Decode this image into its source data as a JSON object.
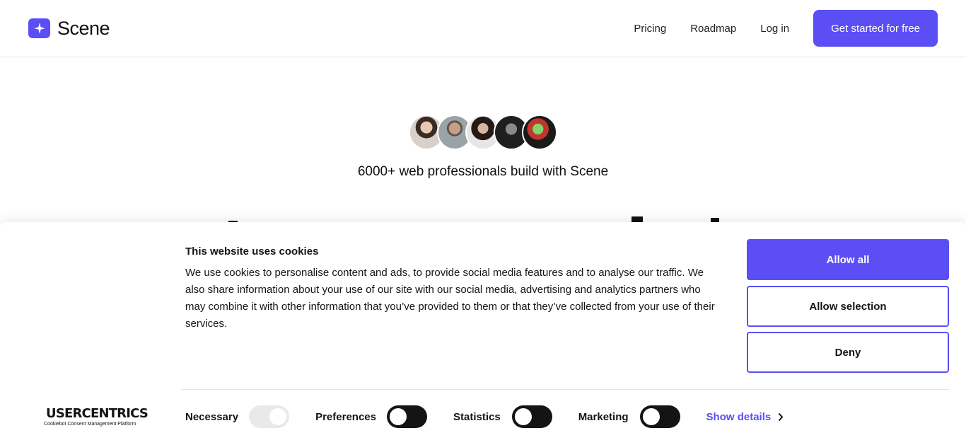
{
  "header": {
    "brand": "Scene",
    "nav": [
      "Pricing",
      "Roadmap",
      "Log in"
    ],
    "cta": "Get started for free"
  },
  "hero": {
    "tagline": "6000+ web professionals build with Scene",
    "headline_partial": "I",
    "avatar_count": 5
  },
  "cookie_banner": {
    "title": "This website uses cookies",
    "body": "We use cookies to personalise content and ads, to provide social media features and to analyse our traffic. We also share information about your use of our site with our social media, advertising and analytics partners who may combine it with other information that you’ve provided to them or that they’ve collected from your use of their services.",
    "buttons": {
      "allow_all": "Allow all",
      "allow_selection": "Allow selection",
      "deny": "Deny"
    },
    "provider": {
      "name": "USERCENTRICS",
      "subtitle": "Cookiebot Consent Management Platform"
    },
    "consents": [
      {
        "label": "Necessary",
        "on": true,
        "disabled": true
      },
      {
        "label": "Preferences",
        "on": false,
        "disabled": false
      },
      {
        "label": "Statistics",
        "on": false,
        "disabled": false
      },
      {
        "label": "Marketing",
        "on": false,
        "disabled": false
      }
    ],
    "show_details": "Show details"
  },
  "colors": {
    "accent": "#5b4ef5",
    "text": "#141414"
  }
}
